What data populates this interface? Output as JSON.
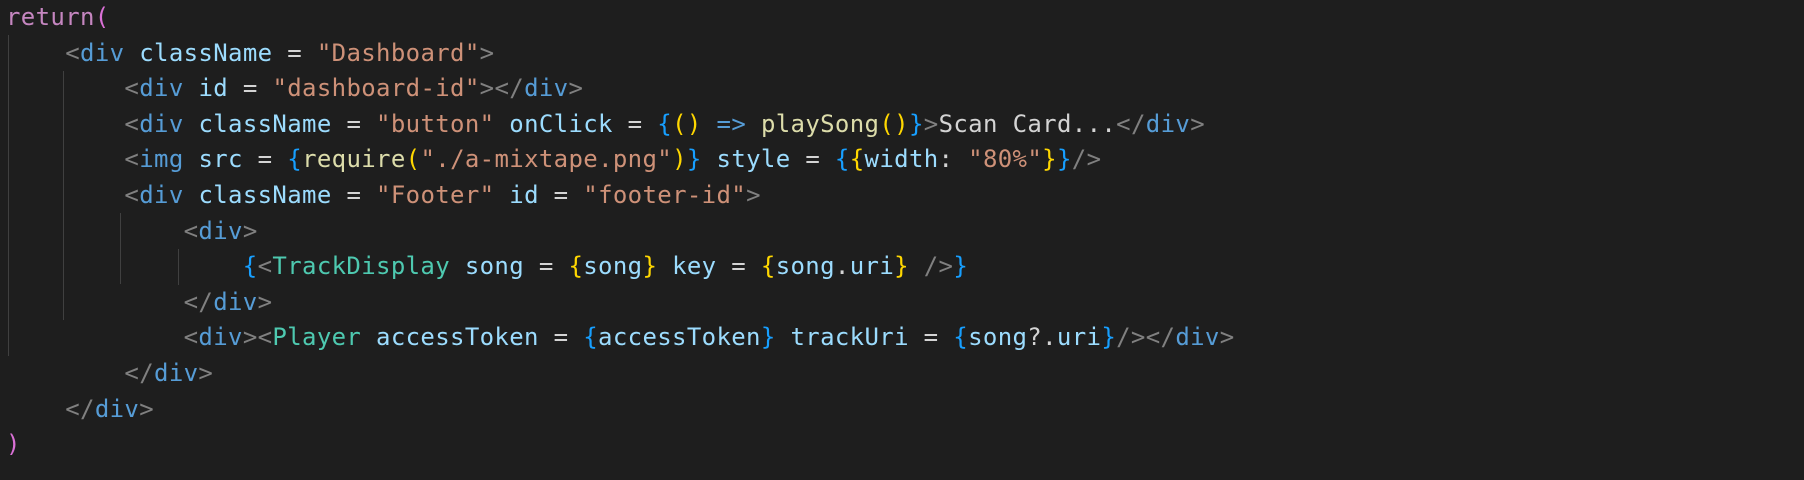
{
  "colors": {
    "background": "#1e1e1e",
    "default": "#d4d4d4",
    "keyword": "#c586c0",
    "tag_bracket": "#808080",
    "tag": "#569cd6",
    "attribute": "#9cdcfe",
    "string": "#ce9178",
    "function": "#dcdcaa",
    "component": "#4ec9b0",
    "brace_1": "#ffd700",
    "brace_2": "#da70d6",
    "brace_3": "#179fff",
    "indent_guide": "#404040"
  },
  "code": {
    "lines": [
      [
        [
          "return",
          "keyword"
        ],
        [
          "(",
          "brace_2"
        ]
      ],
      [
        [
          "    ",
          "default"
        ],
        [
          "<",
          "tag_bracket"
        ],
        [
          "div",
          "tag"
        ],
        [
          " ",
          "default"
        ],
        [
          "className",
          "attribute"
        ],
        [
          " = ",
          "default"
        ],
        [
          "\"Dashboard\"",
          "string"
        ],
        [
          ">",
          "tag_bracket"
        ]
      ],
      [
        [
          "        ",
          "default"
        ],
        [
          "<",
          "tag_bracket"
        ],
        [
          "div",
          "tag"
        ],
        [
          " ",
          "default"
        ],
        [
          "id",
          "attribute"
        ],
        [
          " = ",
          "default"
        ],
        [
          "\"dashboard-id\"",
          "string"
        ],
        [
          "></",
          "tag_bracket"
        ],
        [
          "div",
          "tag"
        ],
        [
          ">",
          "tag_bracket"
        ]
      ],
      [
        [
          "        ",
          "default"
        ],
        [
          "<",
          "tag_bracket"
        ],
        [
          "div",
          "tag"
        ],
        [
          " ",
          "default"
        ],
        [
          "className",
          "attribute"
        ],
        [
          " = ",
          "default"
        ],
        [
          "\"button\"",
          "string"
        ],
        [
          " ",
          "default"
        ],
        [
          "onClick",
          "attribute"
        ],
        [
          " = ",
          "default"
        ],
        [
          "{",
          "brace_3"
        ],
        [
          "()",
          "brace_1"
        ],
        [
          " ",
          "default"
        ],
        [
          "=>",
          "tag"
        ],
        [
          " ",
          "default"
        ],
        [
          "playSong",
          "function"
        ],
        [
          "()",
          "brace_1"
        ],
        [
          "}",
          "brace_3"
        ],
        [
          ">",
          "tag_bracket"
        ],
        [
          "Scan Card...",
          "default"
        ],
        [
          "</",
          "tag_bracket"
        ],
        [
          "div",
          "tag"
        ],
        [
          ">",
          "tag_bracket"
        ]
      ],
      [
        [
          "        ",
          "default"
        ],
        [
          "<",
          "tag_bracket"
        ],
        [
          "img",
          "tag"
        ],
        [
          " ",
          "default"
        ],
        [
          "src",
          "attribute"
        ],
        [
          " = ",
          "default"
        ],
        [
          "{",
          "brace_3"
        ],
        [
          "require",
          "function"
        ],
        [
          "(",
          "brace_1"
        ],
        [
          "\"./a-mixtape.png\"",
          "string"
        ],
        [
          ")",
          "brace_1"
        ],
        [
          "}",
          "brace_3"
        ],
        [
          " ",
          "default"
        ],
        [
          "style",
          "attribute"
        ],
        [
          " = ",
          "default"
        ],
        [
          "{",
          "brace_3"
        ],
        [
          "{",
          "brace_1"
        ],
        [
          "width",
          "attribute"
        ],
        [
          ": ",
          "default"
        ],
        [
          "\"80%\"",
          "string"
        ],
        [
          "}",
          "brace_1"
        ],
        [
          "}",
          "brace_3"
        ],
        [
          "/>",
          "tag_bracket"
        ]
      ],
      [
        [
          "        ",
          "default"
        ],
        [
          "<",
          "tag_bracket"
        ],
        [
          "div",
          "tag"
        ],
        [
          " ",
          "default"
        ],
        [
          "className",
          "attribute"
        ],
        [
          " = ",
          "default"
        ],
        [
          "\"Footer\"",
          "string"
        ],
        [
          " ",
          "default"
        ],
        [
          "id",
          "attribute"
        ],
        [
          " = ",
          "default"
        ],
        [
          "\"footer-id\"",
          "string"
        ],
        [
          ">",
          "tag_bracket"
        ]
      ],
      [
        [
          "            ",
          "default"
        ],
        [
          "<",
          "tag_bracket"
        ],
        [
          "div",
          "tag"
        ],
        [
          ">",
          "tag_bracket"
        ]
      ],
      [
        [
          "                ",
          "default"
        ],
        [
          "{",
          "brace_3"
        ],
        [
          "<",
          "tag_bracket"
        ],
        [
          "TrackDisplay",
          "component"
        ],
        [
          " ",
          "default"
        ],
        [
          "song",
          "attribute"
        ],
        [
          " = ",
          "default"
        ],
        [
          "{",
          "brace_1"
        ],
        [
          "song",
          "attribute"
        ],
        [
          "}",
          "brace_1"
        ],
        [
          " ",
          "default"
        ],
        [
          "key",
          "attribute"
        ],
        [
          " = ",
          "default"
        ],
        [
          "{",
          "brace_1"
        ],
        [
          "song",
          "attribute"
        ],
        [
          ".",
          "default"
        ],
        [
          "uri",
          "attribute"
        ],
        [
          "}",
          "brace_1"
        ],
        [
          " ",
          "default"
        ],
        [
          "/>",
          "tag_bracket"
        ],
        [
          "}",
          "brace_3"
        ]
      ],
      [
        [
          "            ",
          "default"
        ],
        [
          "</",
          "tag_bracket"
        ],
        [
          "div",
          "tag"
        ],
        [
          ">",
          "tag_bracket"
        ]
      ],
      [
        [
          "            ",
          "default"
        ],
        [
          "<",
          "tag_bracket"
        ],
        [
          "div",
          "tag"
        ],
        [
          "><",
          "tag_bracket"
        ],
        [
          "Player",
          "component"
        ],
        [
          " ",
          "default"
        ],
        [
          "accessToken",
          "attribute"
        ],
        [
          " = ",
          "default"
        ],
        [
          "{",
          "brace_3"
        ],
        [
          "accessToken",
          "attribute"
        ],
        [
          "}",
          "brace_3"
        ],
        [
          " ",
          "default"
        ],
        [
          "trackUri",
          "attribute"
        ],
        [
          " = ",
          "default"
        ],
        [
          "{",
          "brace_3"
        ],
        [
          "song",
          "attribute"
        ],
        [
          "?.",
          "default"
        ],
        [
          "uri",
          "attribute"
        ],
        [
          "}",
          "brace_3"
        ],
        [
          "/></",
          "tag_bracket"
        ],
        [
          "div",
          "tag"
        ],
        [
          ">",
          "tag_bracket"
        ]
      ],
      [
        [
          "        ",
          "default"
        ],
        [
          "</",
          "tag_bracket"
        ],
        [
          "div",
          "tag"
        ],
        [
          ">",
          "tag_bracket"
        ]
      ],
      [
        [
          "    ",
          "default"
        ],
        [
          "</",
          "tag_bracket"
        ],
        [
          "div",
          "tag"
        ],
        [
          ">",
          "tag_bracket"
        ]
      ],
      [
        [
          ")",
          "brace_2"
        ]
      ]
    ]
  }
}
